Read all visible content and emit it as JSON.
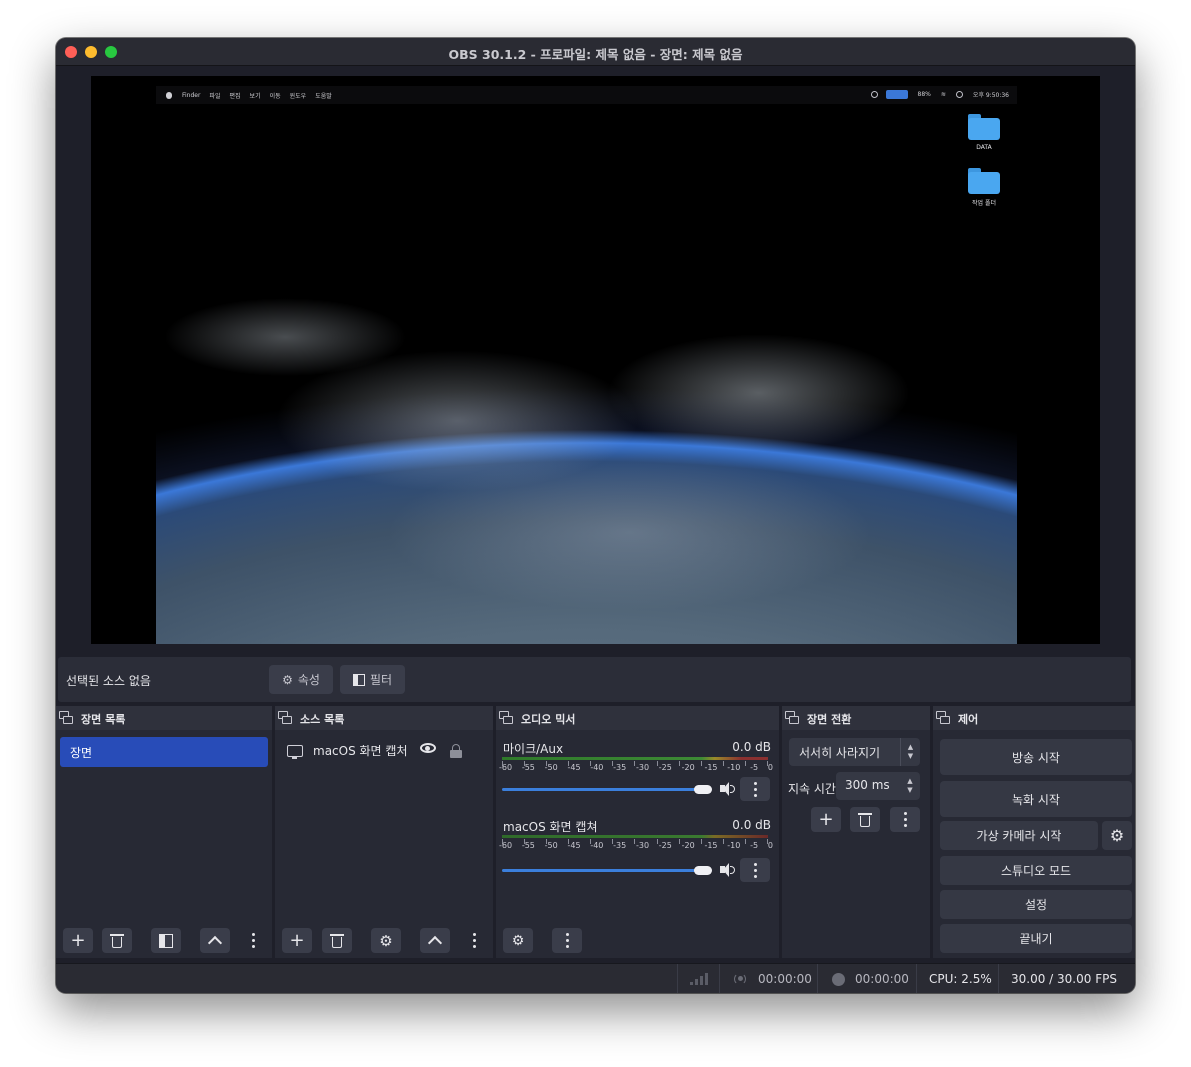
{
  "window": {
    "title": "OBS 30.1.2 - 프로파일: 제목 없음 - 장면: 제목 없음"
  },
  "preview": {
    "menubar": {
      "items": [
        "Finder",
        "파일",
        "편집",
        "보기",
        "이동",
        "윈도우",
        "도움말"
      ],
      "battery": "88%",
      "clock": "오후 9:50:36"
    },
    "desktop_icons": [
      "DATA",
      "작업 폴더"
    ]
  },
  "source_toolbar": {
    "no_source_label": "선택된 소스 없음",
    "properties_label": "속성",
    "filters_label": "필터"
  },
  "docks": {
    "scenes": {
      "title": "장면 목록",
      "items": [
        "장면"
      ]
    },
    "sources": {
      "title": "소스 목록",
      "items": [
        "macOS 화면 캡처"
      ]
    },
    "mixer": {
      "title": "오디오 믹서",
      "scale": [
        "-60",
        "-55",
        "-50",
        "-45",
        "-40",
        "-35",
        "-30",
        "-25",
        "-20",
        "-15",
        "-10",
        "-5",
        "0"
      ],
      "channels": [
        {
          "name": "마이크/Aux",
          "level": "0.0 dB",
          "volume": 1.0
        },
        {
          "name": "macOS 화면 캡쳐",
          "level": "0.0 dB",
          "volume": 1.0
        }
      ]
    },
    "transitions": {
      "title": "장면 전환",
      "selected": "서서히 사라지기",
      "duration_label": "지속 시간",
      "duration_value": "300 ms"
    },
    "controls": {
      "title": "제어",
      "start_stream": "방송 시작",
      "start_record": "녹화 시작",
      "start_virtualcam": "가상 카메라 시작",
      "studio_mode": "스튜디오 모드",
      "settings": "설정",
      "exit": "끝내기"
    }
  },
  "status": {
    "stream_time": "00:00:00",
    "record_time": "00:00:00",
    "cpu": "CPU: 2.5%",
    "fps": "30.00 / 30.00 FPS"
  }
}
